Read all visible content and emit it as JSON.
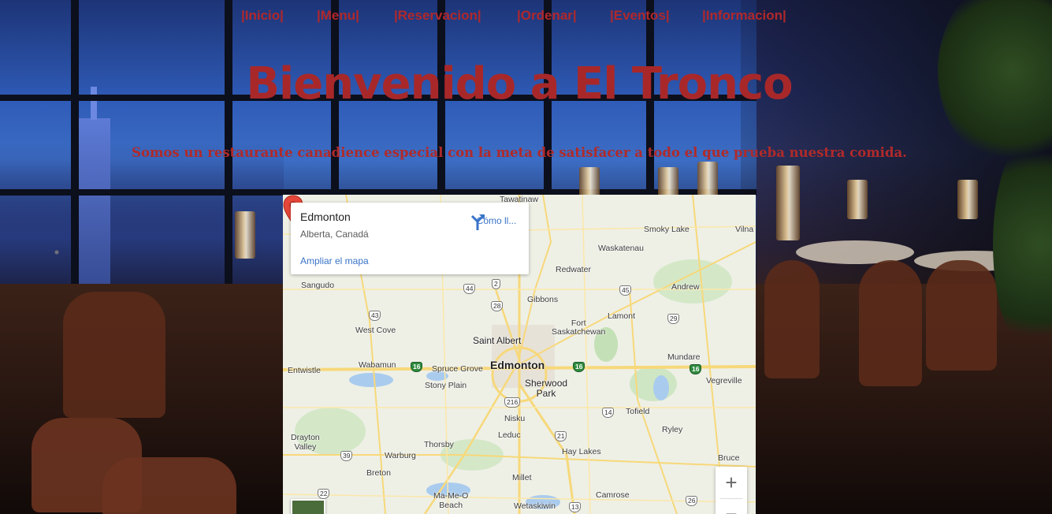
{
  "nav": {
    "items": [
      "|Inicio|",
      "|Menu|",
      "|Reservacion|",
      "|Ordenar|",
      "|Eventos|",
      "|Informacion|"
    ]
  },
  "hero": {
    "title": "Bienvenido a El Tronco",
    "subtitle": "Somos un restaurante canadience especial con la meta de satisfacer a todo el que prueba nuestra comida."
  },
  "map": {
    "card": {
      "title": "Edmonton",
      "subtitle": "Alberta, Canadá",
      "enlarge_link": "Ampliar el mapa",
      "directions_label": "Cómo ll..."
    },
    "zoom_in": "+",
    "zoom_out": "−",
    "places": {
      "tawatinaw": "Tawatinaw",
      "smoky_lake": "Smoky Lake",
      "vilna": "Vilna",
      "waskatenau": "Waskatenau",
      "redwater": "Redwater",
      "sangudo": "Sangudo",
      "gibbons": "Gibbons",
      "andrew": "Andrew",
      "lamont": "Lamont",
      "west_cove": "West Cove",
      "fort_sask": "Fort\nSaskatchewan",
      "saint_albert": "Saint Albert",
      "edmonton": "Edmonton",
      "entwistle": "Entwistle",
      "wabamun": "Wabamun",
      "spruce_grove": "Spruce Grove",
      "stony_plain": "Stony Plain",
      "sherwood_park": "Sherwood\nPark",
      "mundare": "Mundare",
      "vegreville": "Vegreville",
      "tofield": "Tofield",
      "nisku": "Nisku",
      "leduc": "Leduc",
      "drayton_valley": "Drayton\nValley",
      "thorsby": "Thorsby",
      "ryley": "Ryley",
      "warburg": "Warburg",
      "hay_lakes": "Hay Lakes",
      "bruce": "Bruce",
      "breton": "Breton",
      "millet": "Millet",
      "ma_me_o": "Ma-Me-O\nBeach",
      "camrose": "Camrose",
      "wetaskiwin": "Wetaskiwin"
    },
    "routes": {
      "r2": "2",
      "r44": "44",
      "r28": "28",
      "r45": "45",
      "r43": "43",
      "r29": "29",
      "r16a": "16",
      "r16b": "16",
      "r16c": "16",
      "r216": "216",
      "r14": "14",
      "r21": "21",
      "r39": "39",
      "r22": "22",
      "r13": "13",
      "r26": "26"
    }
  }
}
